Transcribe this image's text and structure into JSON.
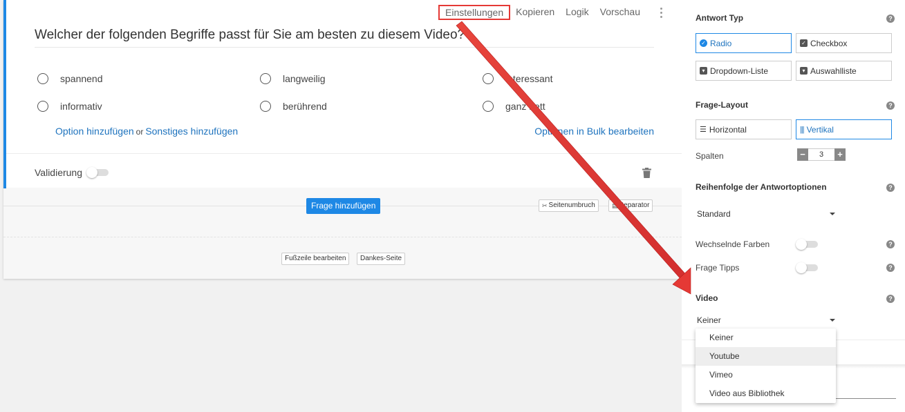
{
  "toolbar": {
    "settings": "Einstellungen",
    "copy": "Kopieren",
    "logic": "Logik",
    "preview": "Vorschau",
    "more_icon": "kebab-icon"
  },
  "question": {
    "title": "Welcher der folgenden Begriffe passt für Sie am besten zu diesem Video?",
    "options": [
      "spannend",
      "langweilig",
      "interessant",
      "informativ",
      "berührend",
      "ganz nett"
    ],
    "add_option": "Option hinzufügen",
    "or": "or",
    "add_other": "Sonstiges hinzufügen",
    "bulk_edit": "Optionen in Bulk bearbeiten",
    "validation_label": "Validierung",
    "validation_enabled": false
  },
  "page": {
    "add_question": "Frage hinzufügen",
    "page_break": "Seitenumbruch",
    "separator": "Separator",
    "edit_footer": "Fußzeile bearbeiten",
    "thanks_page": "Dankes-Seite"
  },
  "panel": {
    "answer_type": {
      "title": "Antwort Typ",
      "selected": "Radio",
      "options": [
        "Radio",
        "Checkbox",
        "Dropdown-Liste",
        "Auswahlliste"
      ]
    },
    "layout": {
      "title": "Frage-Layout",
      "options": [
        "Horizontal",
        "Vertikal"
      ],
      "selected": "Vertikal",
      "columns_label": "Spalten",
      "columns_value": "3",
      "minus": "−",
      "plus": "+"
    },
    "order": {
      "title": "Reihenfolge der Antwortoptionen",
      "value": "Standard"
    },
    "alternating_colors": {
      "label": "Wechselnde Farben",
      "enabled": false
    },
    "tips": {
      "label": "Frage Tipps",
      "enabled": false
    },
    "video": {
      "title": "Video",
      "value": "Keiner",
      "options": [
        "Keiner",
        "Youtube",
        "Vimeo",
        "Video aus Bibliothek"
      ],
      "hovered": "Youtube"
    },
    "help_glyph": "?"
  },
  "colors": {
    "accent": "#1e88e5",
    "link": "#1e73be",
    "annotation_red": "#e53935"
  }
}
